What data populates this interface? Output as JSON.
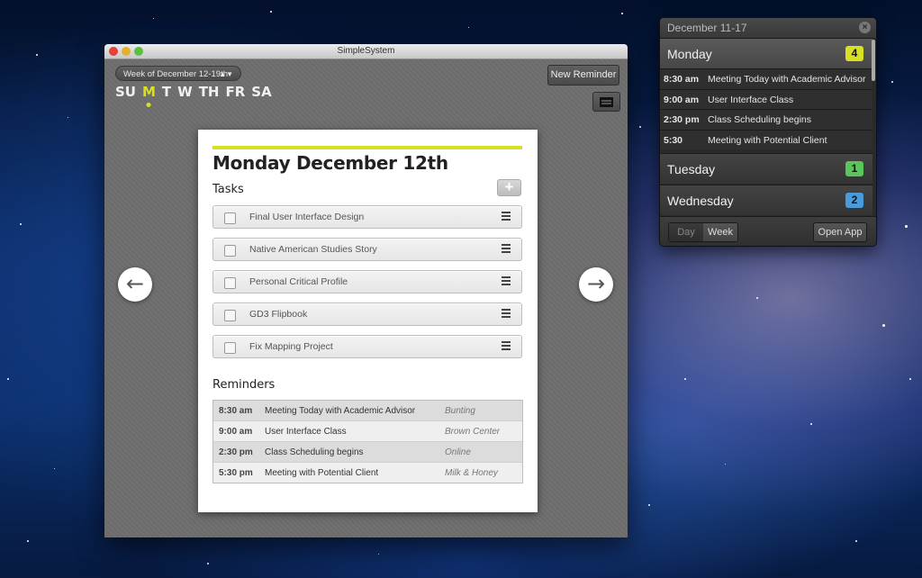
{
  "window": {
    "title": "SimpleSystem",
    "week_select": "Week of December 12-19th",
    "days": [
      "SU",
      "M",
      "T",
      "W",
      "TH",
      "FR",
      "SA"
    ],
    "active_day": "M",
    "new_reminder_label": "New Reminder",
    "nav_left_icon": "arrow-left-icon",
    "nav_right_icon": "arrow-right-icon"
  },
  "paper": {
    "heading": "Monday December 12th",
    "tasks_title": "Tasks",
    "add_label": "+",
    "tasks": [
      "Final User Interface Design",
      "Native American Studies Story",
      "Personal Critical Profile",
      "GD3 Flipbook",
      "Fix Mapping Project"
    ],
    "reminders_title": "Reminders",
    "reminders": [
      {
        "time": "8:30 am",
        "title": "Meeting Today with Academic Advisor",
        "location": "Bunting"
      },
      {
        "time": "9:00 am",
        "title": "User Interface Class",
        "location": "Brown Center"
      },
      {
        "time": "2:30 pm",
        "title": "Class Scheduling begins",
        "location": "Online"
      },
      {
        "time": "5:30 pm",
        "title": "Meeting with Potential Client",
        "location": "Milk & Honey"
      }
    ]
  },
  "widget": {
    "header": "December 11-17",
    "close_icon": "×",
    "days": [
      {
        "name": "Monday",
        "count": "4",
        "color": "#d8e022"
      },
      {
        "name": "Tuesday",
        "count": "1",
        "color": "#5cc45a"
      },
      {
        "name": "Wednesday",
        "count": "2",
        "color": "#4a9bdc"
      }
    ],
    "events": [
      {
        "time": "8:30 am",
        "title": "Meeting Today with Academic Advisor"
      },
      {
        "time": "9:00 am",
        "title": "User Interface Class"
      },
      {
        "time": "2:30 pm",
        "title": "Class Scheduling begins"
      },
      {
        "time": "5:30",
        "title": "Meeting with Potential Client"
      }
    ],
    "seg_day": "Day",
    "seg_week": "Week",
    "open_app": "Open App"
  },
  "colors": {
    "accent": "#d8e022"
  }
}
